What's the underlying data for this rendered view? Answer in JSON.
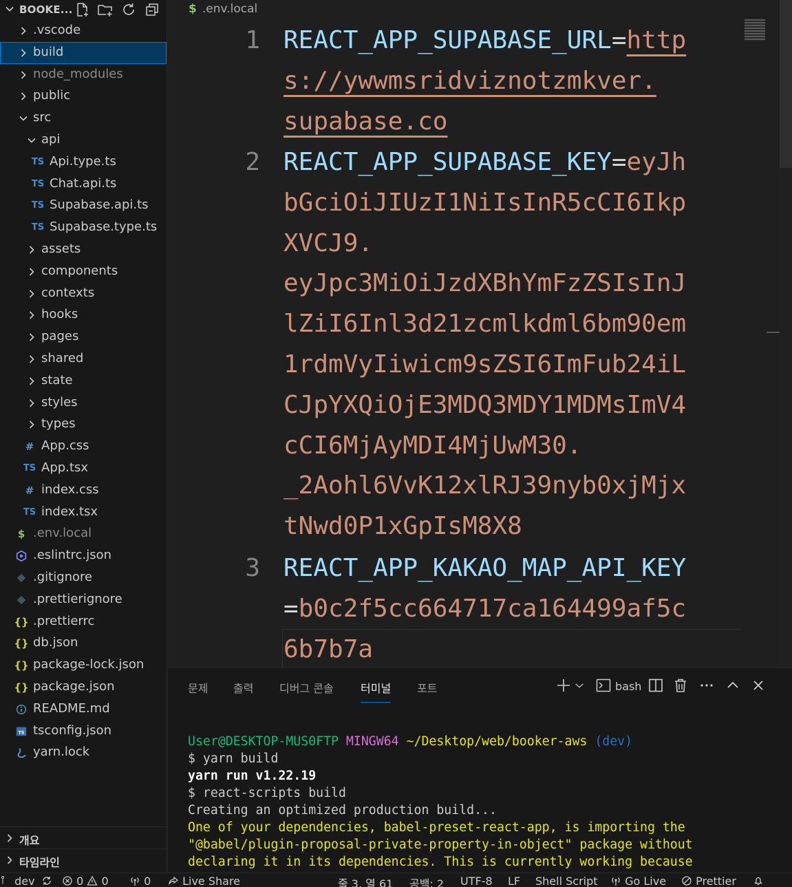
{
  "explorer": {
    "title": "BOOKE...",
    "items": [
      {
        "label": ".vscode",
        "type": "folder",
        "collapsed": true,
        "depth": 0,
        "dim": false,
        "selected": false
      },
      {
        "label": "build",
        "type": "folder",
        "collapsed": true,
        "depth": 0,
        "dim": false,
        "selected": true
      },
      {
        "label": "node_modules",
        "type": "folder",
        "collapsed": true,
        "depth": 0,
        "dim": true,
        "selected": false
      },
      {
        "label": "public",
        "type": "folder",
        "collapsed": true,
        "depth": 0,
        "dim": false,
        "selected": false
      },
      {
        "label": "src",
        "type": "folder",
        "collapsed": false,
        "depth": 0,
        "dim": false,
        "selected": false
      },
      {
        "label": "api",
        "type": "folder",
        "collapsed": false,
        "depth": 1,
        "dim": false,
        "selected": false
      },
      {
        "label": "Api.type.ts",
        "type": "ts",
        "depth": 2
      },
      {
        "label": "Chat.api.ts",
        "type": "ts",
        "depth": 2
      },
      {
        "label": "Supabase.api.ts",
        "type": "ts",
        "depth": 2
      },
      {
        "label": "Supabase.type.ts",
        "type": "ts",
        "depth": 2
      },
      {
        "label": "assets",
        "type": "folder",
        "collapsed": true,
        "depth": 1
      },
      {
        "label": "components",
        "type": "folder",
        "collapsed": true,
        "depth": 1
      },
      {
        "label": "contexts",
        "type": "folder",
        "collapsed": true,
        "depth": 1
      },
      {
        "label": "hooks",
        "type": "folder",
        "collapsed": true,
        "depth": 1
      },
      {
        "label": "pages",
        "type": "folder",
        "collapsed": true,
        "depth": 1
      },
      {
        "label": "shared",
        "type": "folder",
        "collapsed": true,
        "depth": 1
      },
      {
        "label": "state",
        "type": "folder",
        "collapsed": true,
        "depth": 1
      },
      {
        "label": "styles",
        "type": "folder",
        "collapsed": true,
        "depth": 1
      },
      {
        "label": "types",
        "type": "folder",
        "collapsed": true,
        "depth": 1
      },
      {
        "label": "App.css",
        "type": "css",
        "depth": 1
      },
      {
        "label": "App.tsx",
        "type": "ts",
        "depth": 1
      },
      {
        "label": "index.css",
        "type": "css",
        "depth": 1
      },
      {
        "label": "index.tsx",
        "type": "ts",
        "depth": 1
      },
      {
        "label": ".env.local",
        "type": "env",
        "depth": 0,
        "dim": true
      },
      {
        "label": ".eslintrc.json",
        "type": "eslint",
        "depth": 0
      },
      {
        "label": ".gitignore",
        "type": "git",
        "depth": 0
      },
      {
        "label": ".prettierignore",
        "type": "git",
        "depth": 0
      },
      {
        "label": ".prettierrc",
        "type": "json",
        "depth": 0
      },
      {
        "label": "db.json",
        "type": "json",
        "depth": 0
      },
      {
        "label": "package-lock.json",
        "type": "json",
        "depth": 0
      },
      {
        "label": "package.json",
        "type": "json",
        "depth": 0
      },
      {
        "label": "README.md",
        "type": "info",
        "depth": 0
      },
      {
        "label": "tsconfig.json",
        "type": "tsconfig",
        "depth": 0
      },
      {
        "label": "yarn.lock",
        "type": "yarn",
        "depth": 0
      }
    ],
    "outline_label": "개요",
    "timeline_label": "타임라인"
  },
  "editor": {
    "breadcrumb_icon": "$",
    "breadcrumb": ".env.local",
    "lines": [
      {
        "number": "1",
        "visual": [
          {
            "key": "REACT_APP_SUPABASE_URL",
            "eq": "=",
            "val": "http",
            "link": true
          },
          {
            "val": "s://ywwmsridviznotzmkver.",
            "link": true
          },
          {
            "val": "supabase.co",
            "link": true
          }
        ]
      },
      {
        "number": "2",
        "visual": [
          {
            "key": "REACT_APP_SUPABASE_KEY",
            "eq": "=",
            "val": "eyJh"
          },
          {
            "val": "bGciOiJIUzI1NiIsInR5cCI6Ikp"
          },
          {
            "val": "XVCJ9."
          },
          {
            "val": "eyJpc3MiOiJzdXBhYmFzZSIsInJ"
          },
          {
            "val": "lZiI6Inl3d21zcmlkdml6bm90em"
          },
          {
            "val": "1rdmVyIiwicm9sZSI6ImFub24iL"
          },
          {
            "val": "CJpYXQiOjE3MDQ3MDY1MDMsImV4"
          },
          {
            "val": "cCI6MjAyMDI4MjUwM30."
          },
          {
            "val": "_2Aohl6VvK12xlRJ39nyb0xjMjx"
          },
          {
            "val": "tNwd0P1xGpIsM8X8"
          }
        ]
      },
      {
        "number": "3",
        "visual": [
          {
            "key": "REACT_APP_KAKAO_MAP_API_KEY"
          },
          {
            "eq": "=",
            "val": "b0c2f5cc664717ca164499af5c"
          },
          {
            "val": "6b7b7a"
          }
        ]
      }
    ]
  },
  "panel": {
    "tabs": [
      {
        "label": "문제",
        "active": false
      },
      {
        "label": "출력",
        "active": false
      },
      {
        "label": "디버그 콘솔",
        "active": false
      },
      {
        "label": "터미널",
        "active": true
      },
      {
        "label": "포트",
        "active": false
      }
    ],
    "terminal_name": "bash",
    "prompt": {
      "user": "User@DESKTOP-MUS0FTP",
      "env": "MINGW64",
      "path": "~/Desktop/web/booker-aws",
      "branch": "(dev)"
    },
    "output": [
      {
        "text": "$ yarn build",
        "style": "plain"
      },
      {
        "text": "yarn run v1.22.19",
        "style": "bold"
      },
      {
        "text": "$ react-scripts build",
        "style": "plain"
      },
      {
        "text": "Creating an optimized production build...",
        "style": "plain"
      },
      {
        "text": "One of your dependencies, babel-preset-react-app, is importing the",
        "style": "yellow"
      },
      {
        "text": "\"@babel/plugin-proposal-private-property-in-object\" package without",
        "style": "yellow"
      },
      {
        "text": "declaring it in its dependencies. This is currently working because",
        "style": "yellow"
      }
    ]
  },
  "statusbar": {
    "branch": "dev",
    "errors": "0",
    "warnings": "0",
    "ports": "0",
    "live_share": "Live Share",
    "position": "줄 3, 열 61",
    "spaces": "공백: 2",
    "encoding": "UTF-8",
    "eol": "LF",
    "language": "Shell Script",
    "go_live": "Go Live",
    "prettier": "Prettier"
  },
  "colors": {
    "selection_bg": "#04395e",
    "focus_border": "#0078d4",
    "env_key": "#9cdcfe",
    "env_value": "#ce9178"
  }
}
